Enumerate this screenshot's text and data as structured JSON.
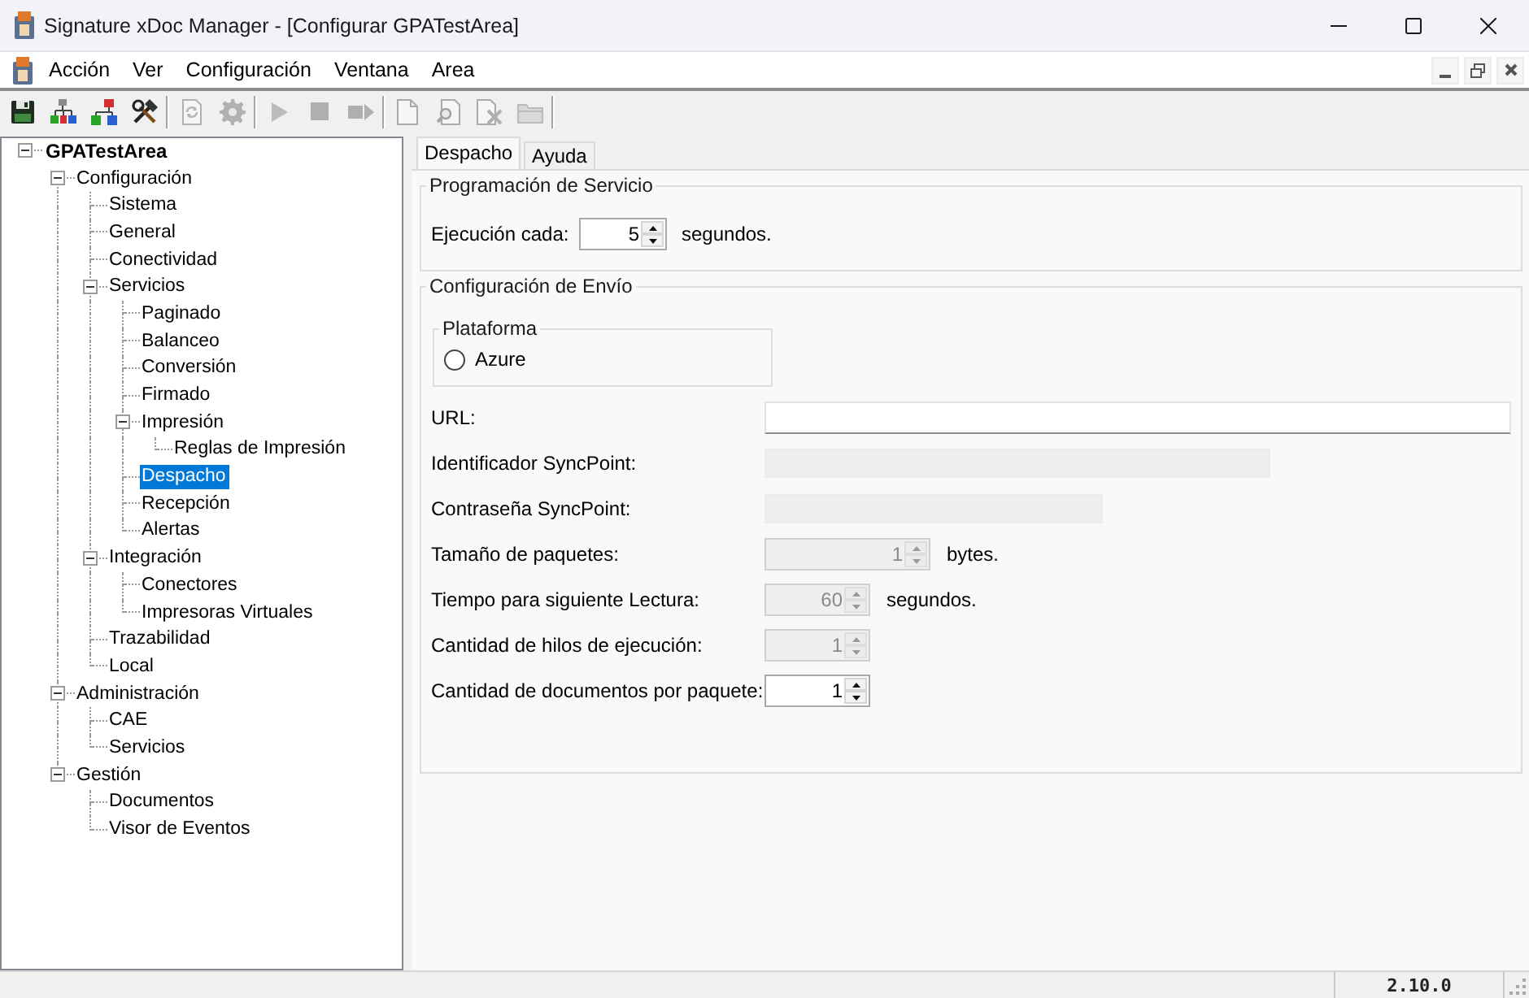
{
  "window": {
    "title": "Signature xDoc Manager - [Configurar GPATestArea]"
  },
  "menu_bar": {
    "items": [
      "Acción",
      "Ver",
      "Configuración",
      "Ventana",
      "Area"
    ]
  },
  "toolbar": {
    "groups": [
      [
        {
          "kind": "save",
          "disabled": false
        },
        {
          "kind": "hierarchy",
          "disabled": false
        },
        {
          "kind": "hierarchy_alt",
          "disabled": false
        },
        {
          "kind": "tools",
          "disabled": false
        }
      ],
      [
        {
          "kind": "refresh",
          "disabled": true
        },
        {
          "kind": "gear",
          "disabled": true
        }
      ],
      [
        {
          "kind": "play",
          "disabled": true
        },
        {
          "kind": "stop",
          "disabled": true
        },
        {
          "kind": "next",
          "disabled": true
        }
      ],
      [
        {
          "kind": "page",
          "disabled": true
        },
        {
          "kind": "page_search",
          "disabled": true
        },
        {
          "kind": "page_remove",
          "disabled": true
        },
        {
          "kind": "folder",
          "disabled": true
        }
      ]
    ]
  },
  "tree": {
    "items": [
      {
        "label": "GPATestArea",
        "expanded": true,
        "selected": false,
        "children": [
          {
            "label": "Configuración",
            "expanded": true,
            "selected": false,
            "children": [
              {
                "label": "Sistema",
                "selected": false
              },
              {
                "label": "General",
                "selected": false
              },
              {
                "label": "Conectividad",
                "selected": false
              },
              {
                "label": "Servicios",
                "expanded": true,
                "selected": false,
                "children": [
                  {
                    "label": "Paginado",
                    "selected": false
                  },
                  {
                    "label": "Balanceo",
                    "selected": false
                  },
                  {
                    "label": "Conversión",
                    "selected": false
                  },
                  {
                    "label": "Firmado",
                    "selected": false
                  },
                  {
                    "label": "Impresión",
                    "expanded": true,
                    "selected": false,
                    "children": [
                      {
                        "label": "Reglas de Impresión",
                        "selected": false
                      }
                    ]
                  },
                  {
                    "label": "Despacho",
                    "selected": true
                  },
                  {
                    "label": "Recepción",
                    "selected": false
                  },
                  {
                    "label": "Alertas",
                    "selected": false
                  }
                ]
              },
              {
                "label": "Integración",
                "expanded": true,
                "selected": false,
                "children": [
                  {
                    "label": "Conectores",
                    "selected": false
                  },
                  {
                    "label": "Impresoras Virtuales",
                    "selected": false
                  }
                ]
              },
              {
                "label": "Trazabilidad",
                "selected": false
              },
              {
                "label": "Local",
                "selected": false
              }
            ]
          },
          {
            "label": "Administración",
            "expanded": true,
            "selected": false,
            "children": [
              {
                "label": "CAE",
                "selected": false
              },
              {
                "label": "Servicios",
                "selected": false
              }
            ]
          },
          {
            "label": "Gestión",
            "expanded": true,
            "selected": false,
            "children": [
              {
                "label": "Documentos",
                "selected": false
              },
              {
                "label": "Visor de Eventos",
                "selected": false
              }
            ]
          }
        ]
      }
    ]
  },
  "tabs": [
    {
      "label": "Despacho",
      "selected": true
    },
    {
      "label": "Ayuda",
      "selected": false
    }
  ],
  "service_schedule": {
    "title": "Programación de Servicio",
    "fields": [
      {
        "kind": "spinner",
        "label": "Ejecución cada:",
        "value": "5",
        "unit": "segundos.",
        "disabled": false
      }
    ]
  },
  "send_config": {
    "title": "Configuración de Envío",
    "platform": {
      "title": "Plataforma",
      "options": [
        {
          "label": "Azure",
          "selected": false
        }
      ]
    },
    "fields": [
      {
        "kind": "text",
        "label": "URL:",
        "disabled": false
      },
      {
        "kind": "text",
        "label": "Identificador SyncPoint:",
        "disabled": true
      },
      {
        "kind": "text",
        "label": "Contraseña SyncPoint:",
        "disabled": true
      },
      {
        "kind": "spinner",
        "label": "Tamaño de paquetes:",
        "value": "1",
        "unit": "bytes.",
        "disabled": true
      },
      {
        "kind": "spinner",
        "label": "Tiempo para siguiente Lectura:",
        "value": "60",
        "unit": "segundos.",
        "disabled": true
      },
      {
        "kind": "spinner",
        "label": "Cantidad de hilos de ejecución:",
        "value": "1",
        "disabled": true
      },
      {
        "kind": "spinner",
        "label": "Cantidad de documentos por paquete:",
        "value": "1",
        "disabled": false
      }
    ]
  },
  "status_bar": {
    "version": "2.10.0"
  }
}
